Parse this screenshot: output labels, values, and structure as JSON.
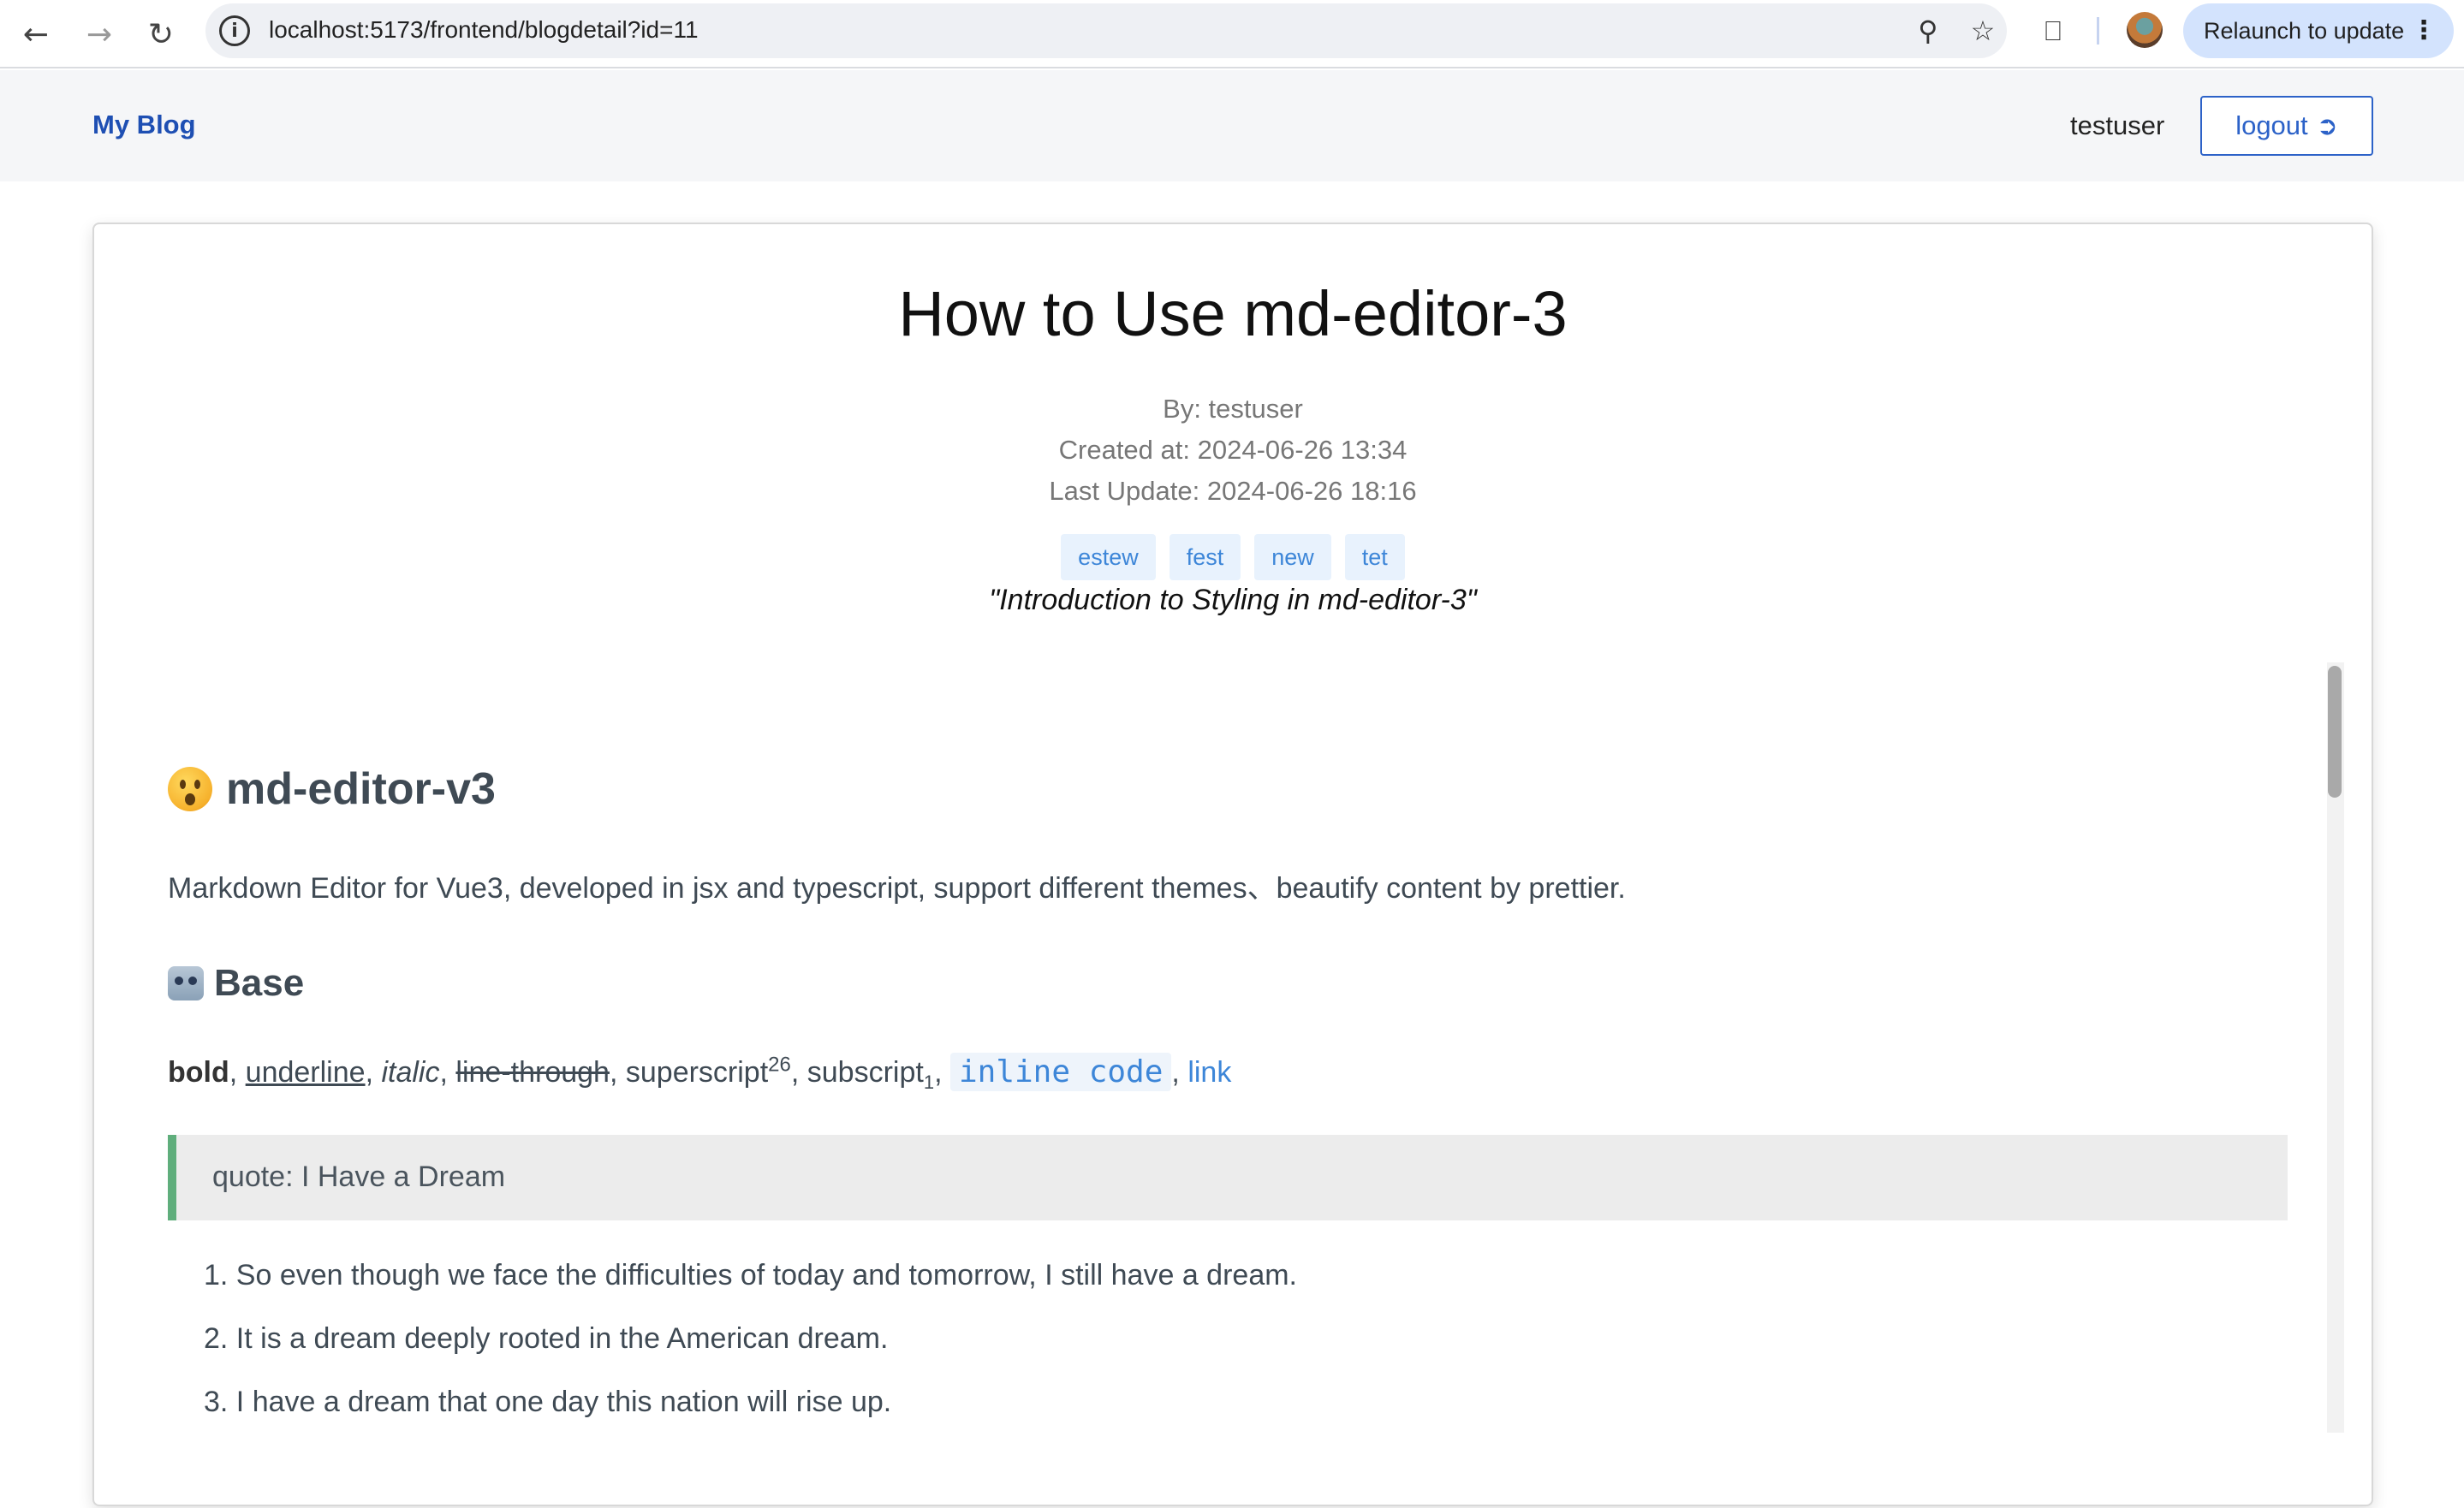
{
  "browser": {
    "url": "localhost:5173/frontend/blogdetail?id=11",
    "relaunch_label": "Relaunch to update",
    "icons": [
      "back-icon",
      "forward-icon",
      "reload-icon",
      "info-icon",
      "zoom-icon",
      "star-icon",
      "extensions-icon",
      "more-icon"
    ]
  },
  "header": {
    "brand": "My Blog",
    "username": "testuser",
    "logout_label": "logout"
  },
  "post": {
    "title": "How to Use md-editor-3",
    "author": "By: testuser",
    "created": "Created at: 2024-06-26 13:34",
    "updated": "Last Update: 2024-06-26 18:16",
    "tags": [
      "estew",
      "fest",
      "new",
      "tet"
    ],
    "summary": "\"Introduction to Styling in md-editor-3\""
  },
  "content": {
    "h1": "md-editor-v3",
    "intro": "Markdown Editor for Vue3, developed in jsx and typescript, support different themes、beautify content by prettier.",
    "h2": "Base",
    "base": {
      "bold": "bold",
      "underline": "underline",
      "italic": "italic",
      "strike": "line-through",
      "superscript": "superscript",
      "sup": "26",
      "subscript": "subscript",
      "sub": "1",
      "code": "inline code",
      "link": "link",
      "sep": ", "
    },
    "quote": "quote: I Have a Dream",
    "list": [
      "1. So even though we face the difficulties of today and tomorrow, I still have a dream.",
      "2. It is a dream deeply rooted in the American dream.",
      "3. I have a dream that one day this nation will rise up."
    ]
  },
  "colors": {
    "brand": "#1e4fb3",
    "accent": "#3d86d8",
    "quote_border": "#5fae7c"
  }
}
